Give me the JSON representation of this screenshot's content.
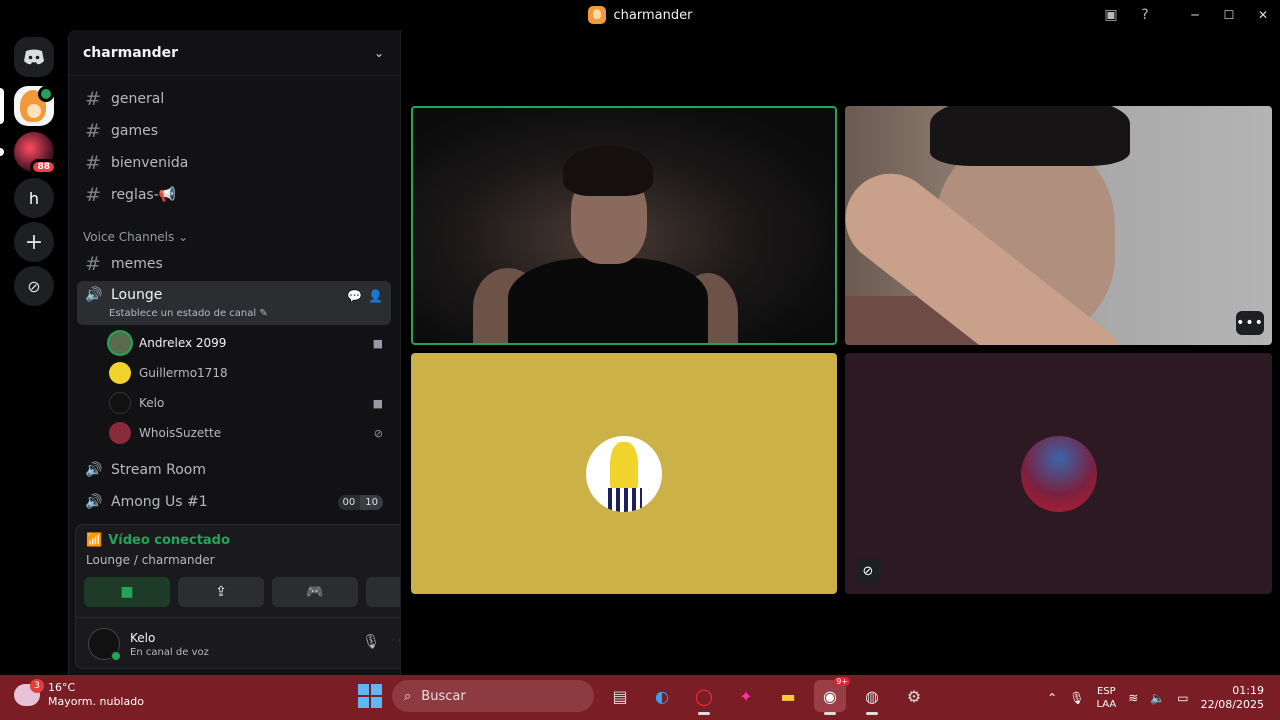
{
  "window": {
    "title": "charmander",
    "help_glyph": "?"
  },
  "rail": {
    "server2_badge": "88",
    "server3_letter": "h",
    "add_glyph": "+",
    "explore_glyph": "⊘"
  },
  "server": {
    "name": "charmander",
    "text_channels": [
      {
        "name": "general"
      },
      {
        "name": "games"
      },
      {
        "name": "bienvenida"
      },
      {
        "name": "reglas-📢"
      }
    ],
    "voice_category": "Voice Channels ⌄",
    "memes_channel": "memes",
    "lounge": {
      "name": "Lounge",
      "status": "Establece un estado de canal ✎"
    },
    "members": [
      {
        "name": "Andrelex 2099",
        "speaking": true
      },
      {
        "name": "Guillermo1718",
        "speaking": false
      },
      {
        "name": "Kelo",
        "speaking": false
      },
      {
        "name": "WhoisSuzette",
        "speaking": false
      }
    ],
    "stream_room": "Stream Room",
    "among_us": {
      "name": "Among Us #1",
      "current": "00",
      "limit": "10"
    }
  },
  "voice_panel": {
    "title": "Vídeo conectado",
    "subtitle": "Lounge / charmander",
    "user_name": "Kelo",
    "user_status": "En canal de voz"
  },
  "taskbar": {
    "weather_temp": "16°C",
    "weather_desc": "Mayorm. nublado",
    "weather_badge": "3",
    "search_placeholder": "Buscar",
    "lang_top": "ESP",
    "lang_bottom": "LAA",
    "time": "01:19",
    "date": "22/08/2025",
    "discord_badge": "9+"
  },
  "colors": {
    "accent_green": "#23a559",
    "taskbar_bg": "#7a1d24",
    "tile_yellow": "#cbb147",
    "tile_purple": "#2c1922"
  }
}
